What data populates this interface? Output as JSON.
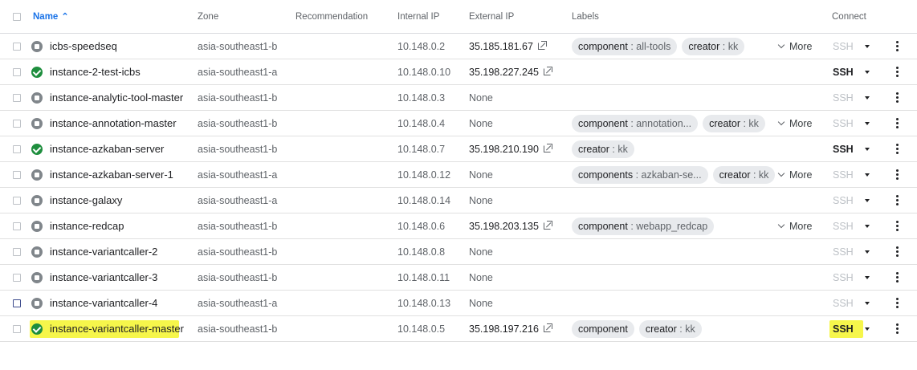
{
  "header": {
    "name": "Name",
    "sort_icon": "sort-ascending-icon",
    "zone": "Zone",
    "recommendation": "Recommendation",
    "internal_ip": "Internal IP",
    "external_ip": "External IP",
    "labels": "Labels",
    "connect": "Connect"
  },
  "more_label": "More",
  "ssh_label": "SSH",
  "colors": {
    "accent": "#1a73e8",
    "running": "#1e8e3e",
    "stopped": "#80868b",
    "highlight": "#f6f64b"
  },
  "rows": [
    {
      "name": "icbs-speedseq",
      "status": "stopped",
      "zone": "asia-southeast1-b",
      "internal_ip": "10.148.0.2",
      "external_ip": "35.185.181.67",
      "ext_link": true,
      "labels": [
        {
          "k": "component",
          "v": "all-tools"
        },
        {
          "k": "creator",
          "v": "kk"
        }
      ],
      "more": true,
      "ssh_enabled": false
    },
    {
      "name": "instance-2-test-icbs",
      "status": "running",
      "zone": "asia-southeast1-a",
      "internal_ip": "10.148.0.10",
      "external_ip": "35.198.227.245",
      "ext_link": true,
      "labels": [],
      "more": false,
      "ssh_enabled": true
    },
    {
      "name": "instance-analytic-tool-master",
      "status": "stopped",
      "zone": "asia-southeast1-b",
      "internal_ip": "10.148.0.3",
      "external_ip": "None",
      "ext_link": false,
      "labels": [],
      "more": false,
      "ssh_enabled": false
    },
    {
      "name": "instance-annotation-master",
      "status": "stopped",
      "zone": "asia-southeast1-b",
      "internal_ip": "10.148.0.4",
      "external_ip": "None",
      "ext_link": false,
      "labels": [
        {
          "k": "component",
          "v": "annotation..."
        },
        {
          "k": "creator",
          "v": "kk"
        }
      ],
      "more": true,
      "ssh_enabled": false
    },
    {
      "name": "instance-azkaban-server",
      "status": "running",
      "zone": "asia-southeast1-b",
      "internal_ip": "10.148.0.7",
      "external_ip": "35.198.210.190",
      "ext_link": true,
      "labels": [
        {
          "k": "creator",
          "v": "kk"
        }
      ],
      "more": false,
      "ssh_enabled": true
    },
    {
      "name": "instance-azkaban-server-1",
      "status": "stopped",
      "zone": "asia-southeast1-a",
      "internal_ip": "10.148.0.12",
      "external_ip": "None",
      "ext_link": false,
      "labels": [
        {
          "k": "components",
          "v": "azkaban-se..."
        },
        {
          "k": "creator",
          "v": "kk"
        }
      ],
      "more": true,
      "ssh_enabled": false
    },
    {
      "name": "instance-galaxy",
      "status": "stopped",
      "zone": "asia-southeast1-a",
      "internal_ip": "10.148.0.14",
      "external_ip": "None",
      "ext_link": false,
      "labels": [],
      "more": false,
      "ssh_enabled": false
    },
    {
      "name": "instance-redcap",
      "status": "stopped",
      "zone": "asia-southeast1-b",
      "internal_ip": "10.148.0.6",
      "external_ip": "35.198.203.135",
      "ext_link": true,
      "labels": [
        {
          "k": "component",
          "v": "webapp_redcap"
        }
      ],
      "more": true,
      "ssh_enabled": false
    },
    {
      "name": "instance-variantcaller-2",
      "status": "stopped",
      "zone": "asia-southeast1-b",
      "internal_ip": "10.148.0.8",
      "external_ip": "None",
      "ext_link": false,
      "labels": [],
      "more": false,
      "ssh_enabled": false
    },
    {
      "name": "instance-variantcaller-3",
      "status": "stopped",
      "zone": "asia-southeast1-b",
      "internal_ip": "10.148.0.11",
      "external_ip": "None",
      "ext_link": false,
      "labels": [],
      "more": false,
      "ssh_enabled": false
    },
    {
      "name": "instance-variantcaller-4",
      "status": "stopped",
      "zone": "asia-southeast1-a",
      "internal_ip": "10.148.0.13",
      "external_ip": "None",
      "ext_link": false,
      "labels": [],
      "more": false,
      "ssh_enabled": false,
      "checkbox_focused": true
    },
    {
      "name": "instance-variantcaller-master",
      "status": "running",
      "zone": "asia-southeast1-b",
      "internal_ip": "10.148.0.5",
      "external_ip": "35.198.197.216",
      "ext_link": true,
      "labels": [
        {
          "k": "component",
          "v": ""
        },
        {
          "k": "creator",
          "v": "kk"
        }
      ],
      "more": false,
      "ssh_enabled": true,
      "highlighted": true
    }
  ]
}
